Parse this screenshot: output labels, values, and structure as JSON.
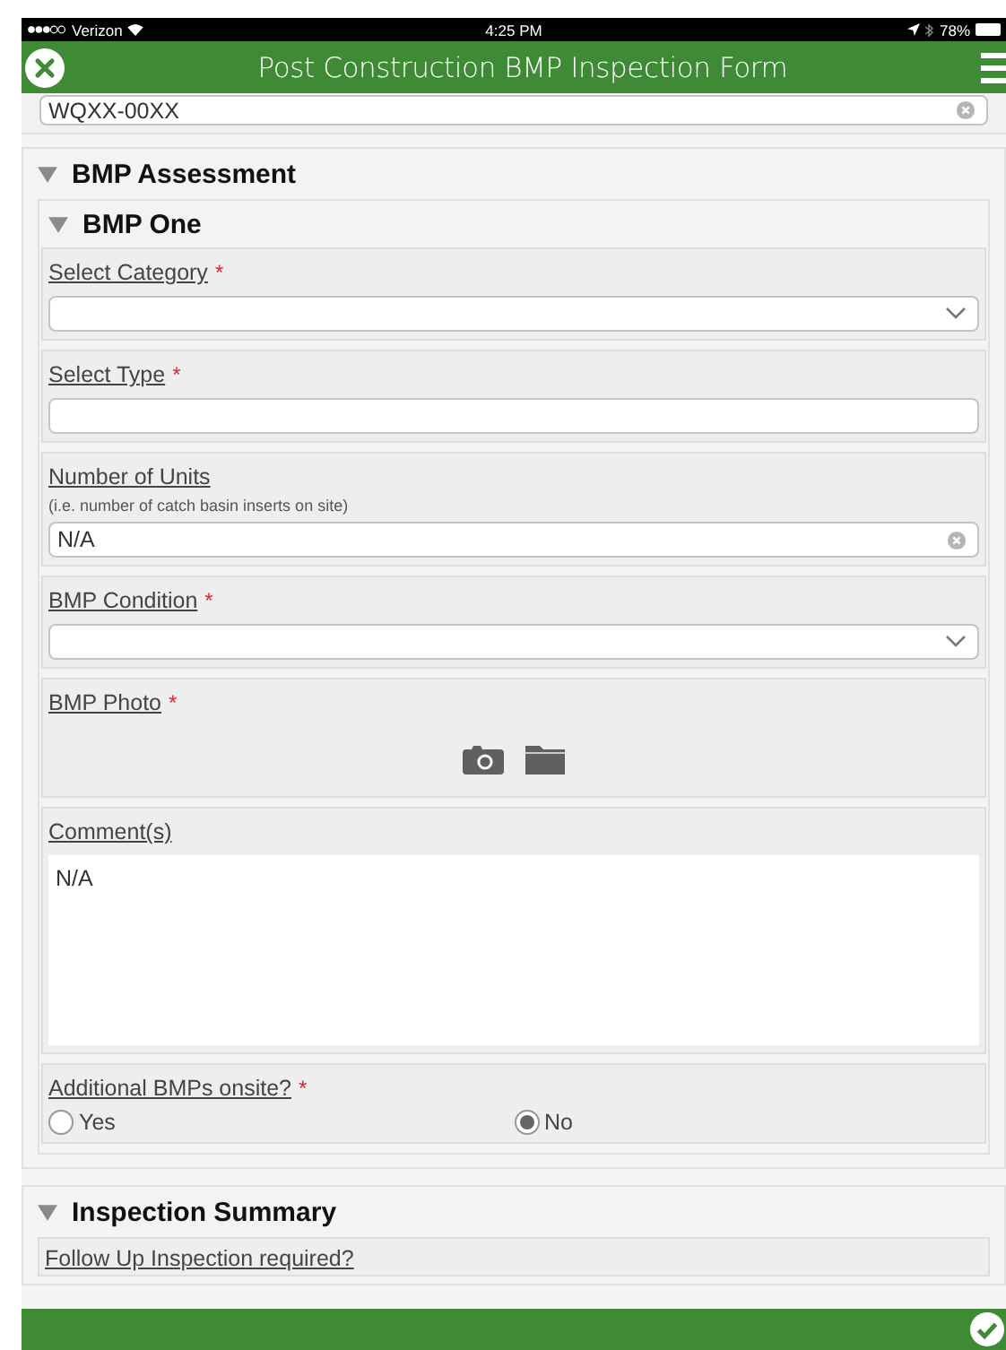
{
  "status_bar": {
    "carrier": "Verizon",
    "time": "4:25 PM",
    "battery": "78%"
  },
  "header": {
    "title": "Post Construction BMP Inspection Form"
  },
  "top_field": {
    "value": "WQXX-00XX",
    "clearable": true
  },
  "sections": [
    {
      "title": "BMP Assessment",
      "expanded": true,
      "items": [
        {
          "kind": "group",
          "title": "BMP One",
          "expanded": true,
          "items": [
            {
              "kind": "select",
              "label": "Select Category",
              "required_mark": "*"
            },
            {
              "kind": "text",
              "label": "Select Type",
              "required_mark": "*"
            },
            {
              "kind": "text",
              "label": "Number of Units",
              "hint": "(i.e. number of catch basin inserts on site)",
              "value": "N/A",
              "clearable": true
            },
            {
              "kind": "select",
              "label": "BMP Condition",
              "required_mark": "*"
            },
            {
              "kind": "photo",
              "label": "BMP Photo",
              "required_mark": "*"
            },
            {
              "kind": "textarea",
              "label": "Comment(s)",
              "value": "N/A"
            },
            {
              "kind": "radio",
              "label": "Additional BMPs onsite?",
              "required_mark": "*",
              "options": [
                {
                  "label": "Yes",
                  "selected": false
                },
                {
                  "label": "No",
                  "selected": true
                }
              ]
            }
          ]
        }
      ]
    },
    {
      "title": "Inspection Summary",
      "expanded": true,
      "items": [
        {
          "kind": "question",
          "label": "Follow Up Inspection required?"
        }
      ]
    }
  ]
}
